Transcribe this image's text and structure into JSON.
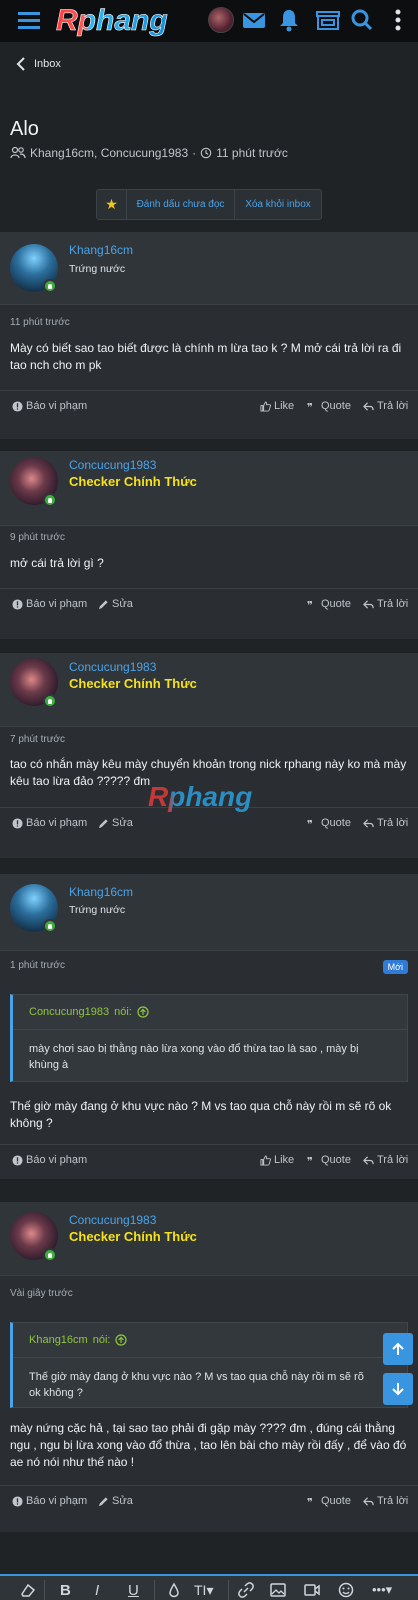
{
  "header": {
    "logo_text": "Rphang"
  },
  "page": {
    "back_label": "Inbox",
    "title": "Alo",
    "participants": "Khang16cm, Concucung1983",
    "time_ago": "11 phút trước",
    "actions": {
      "mark_unread": "Đánh dấu chưa đọc",
      "remove": "Xóa khỏi inbox"
    }
  },
  "common": {
    "report": "Báo vi phạm",
    "edit": "Sửa",
    "like": "Like",
    "quote": "Quote",
    "reply": "Trả lời",
    "said_suffix": "nói:",
    "new_badge": "Mới"
  },
  "messages": [
    {
      "user": "Khang16cm",
      "title": "Trứng nước",
      "time": "11 phút trước",
      "body": "Mày có biết sao tao biết được là chính m lừa tao k ? M mở cái trả lời ra đi tao nch cho m pk"
    },
    {
      "user": "Concucung1983",
      "title": "Checker Chính Thức",
      "time": "9 phút trước",
      "body": "mở cái trả lời gì ?"
    },
    {
      "user": "Concucung1983",
      "title": "Checker Chính Thức",
      "time": "7 phút trước",
      "body": "tao có nhắn mày kêu mày chuyển khoản trong nick rphang này ko mà mày kêu tao lừa đảo ????? đm"
    },
    {
      "user": "Khang16cm",
      "title": "Trứng nước",
      "time": "1 phút trước",
      "quote_user": "Concucung1983",
      "quote_body": "mày chơi sao bị thằng nào lừa xong vào đổ thừa tao là sao , mày bị khùng à",
      "body": "Thế giờ mày đang ở khu vực nào ? M vs tao qua chỗ này rồi m sẽ rõ ok không ?"
    },
    {
      "user": "Concucung1983",
      "title": "Checker Chính Thức",
      "time": "Vài giây trước",
      "quote_user": "Khang16cm",
      "quote_body": "Thế giờ mày đang ở khu vực nào ? M vs tao qua chỗ này rồi m sẽ rõ ok không ?",
      "body": "mày nứng cặc hả , tại sao tao phải đi gặp mày ???? đm , đúng cái thằng ngu , ngu bị lừa xong vào đổ thừa , tao lên bài cho mày rồi đấy , để vào đó ae nó nói như thế nào !"
    }
  ],
  "colors": {
    "link": "#4ba3e8",
    "checker": "#f5e21b",
    "online": "#3fae3f",
    "accent": "#3a95e0"
  }
}
